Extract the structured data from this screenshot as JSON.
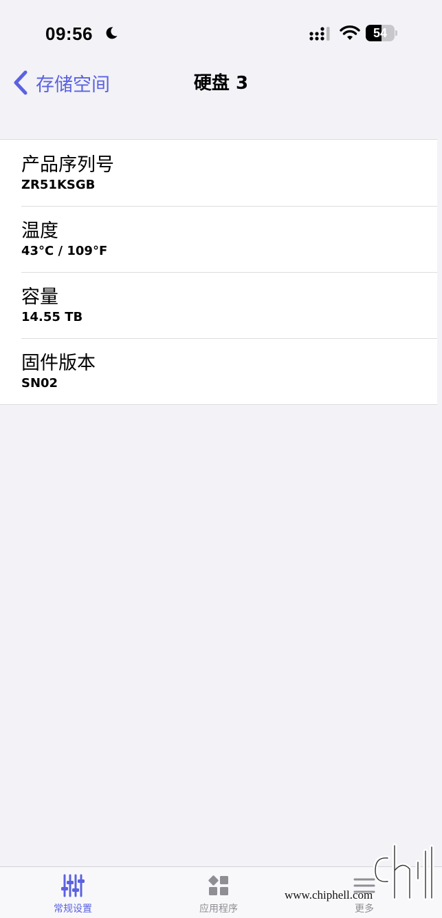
{
  "status_bar": {
    "time": "09:56",
    "battery_level": 54,
    "battery_text": "54"
  },
  "nav": {
    "back_label": "存储空间",
    "title": "硬盘 3"
  },
  "details": [
    {
      "label": "产品序列号",
      "value": "ZR51KSGB"
    },
    {
      "label": "温度",
      "value": "43°C / 109°F"
    },
    {
      "label": "容量",
      "value": "14.55 TB"
    },
    {
      "label": "固件版本",
      "value": "SN02"
    }
  ],
  "tabs": [
    {
      "label": "常规设置",
      "icon": "sliders-icon",
      "active": true
    },
    {
      "label": "应用程序",
      "icon": "apps-grid-icon",
      "active": false
    },
    {
      "label": "更多",
      "icon": "menu-lines-icon",
      "active": false
    }
  ],
  "watermark": {
    "text": "www.chiphell.com"
  },
  "colors": {
    "accent": "#5b62e0",
    "background": "#f2f2f7",
    "inactive": "#8e8e93"
  }
}
